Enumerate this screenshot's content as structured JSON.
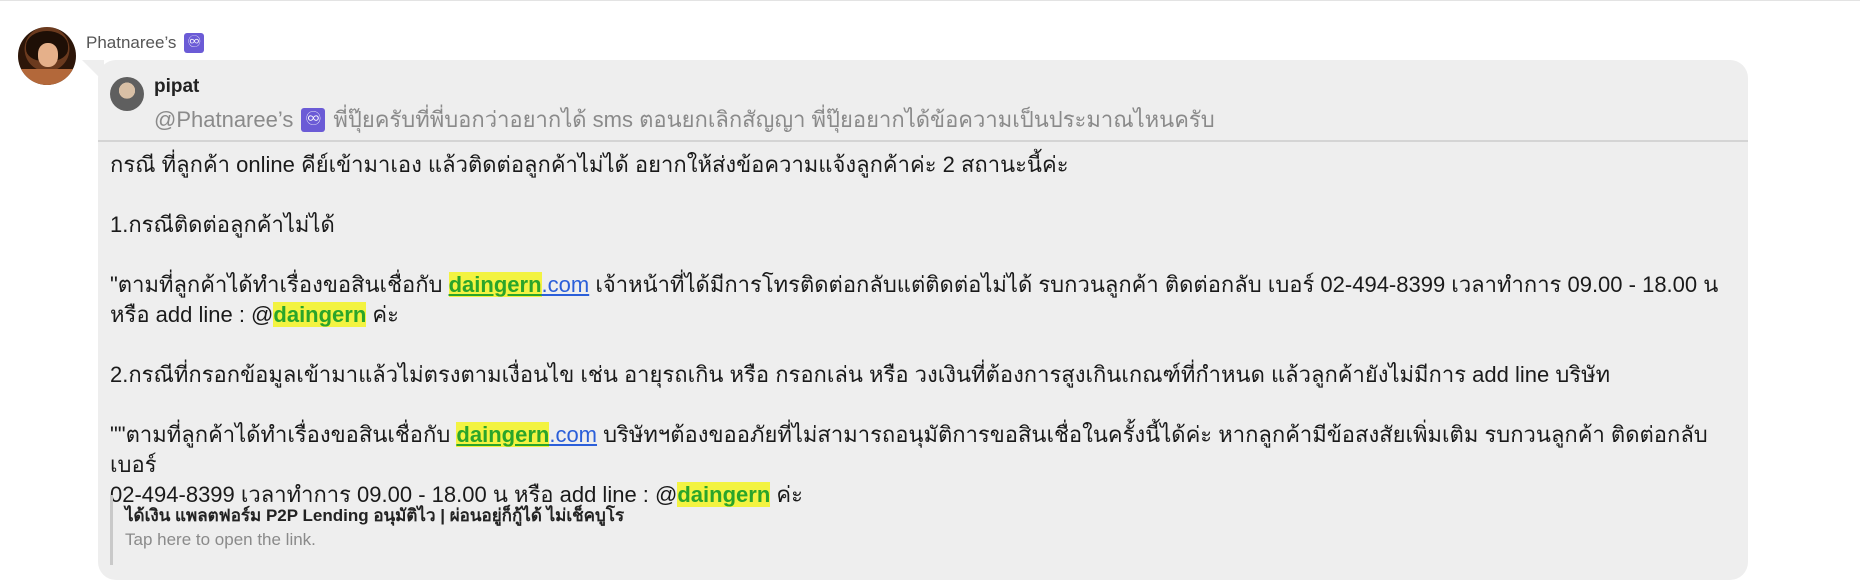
{
  "message": {
    "sender_name": "Phatnaree’s",
    "sender_badge": "♾",
    "reply": {
      "author": "pipat",
      "mention": "@Phatnaree’s",
      "mention_badge": "♾",
      "text": "พี่ปุ๊ยครับที่พี่บอกว่าอยากได้ sms ตอนยกเลิกสัญญา พี่ปุ๊ยอยากได้ข้อความเป็นประมาณไหนครับ"
    },
    "body": {
      "intro": "กรณี ที่ลูกค้า online คีย์เข้ามาเอง แล้วติดต่อลูกค้าไม่ได้ อยากให้ส่งข้อความแจ้งลูกค้าค่ะ 2 สถานะนี้ค่ะ",
      "case1_title": "1.กรณีติดต่อลูกค้าไม่ได้",
      "case1_prefix": "\"ตามที่ลูกค้าได้ทำเรื่องขอสินเชื่อกับ ",
      "brand": "daingern",
      "domain_suffix": ".com",
      "case1_rest": " เจ้าหน้าที่ได้มีการโทรติดต่อกลับแต่ติดต่อไม่ได้ รบกวนลูกค้า ติดต่อกลับ เบอร์ 02-494-8399  เวลาทำการ 09.00 - 18.00 น",
      "case1_line2_prefix": "หรือ add line : @",
      "case1_line2_suffix": " ค่ะ",
      "case2_title": "2.กรณีที่กรอกข้อมูลเข้ามาแล้วไม่ตรงตามเงื่อนไข เช่น อายุรถเกิน หรือ กรอกเล่น หรือ วงเงินที่ต้องการสูงเกินเกณฑ์ที่กำหนด แล้วลูกค้ายังไม่มีการ add line บริษัท",
      "case2_prefix": "\"\"ตามที่ลูกค้าได้ทำเรื่องขอสินเชื่อกับ  ",
      "case2_rest": " บริษัทฯต้องขออภัยที่ไม่สามารถอนุมัติการขอสินเชื่อในครั้งนี้ได้ค่ะ หากลูกค้ามีข้อสงสัยเพิ่มเติม รบกวนลูกค้า ติดต่อกลับ เบอร์",
      "case2_line2_prefix": "02-494-8399  เวลาทำการ 09.00 - 18.00 น หรือ add line : @",
      "case2_line2_suffix": " ค่ะ"
    },
    "link_preview": {
      "title": "ได้เงิน แพลตฟอร์ม P2P Lending อนุมัติไว | ผ่อนอยู่ก็กู้ได้ ไม่เช็คบูโร",
      "hint": "Tap here to open the link."
    }
  }
}
